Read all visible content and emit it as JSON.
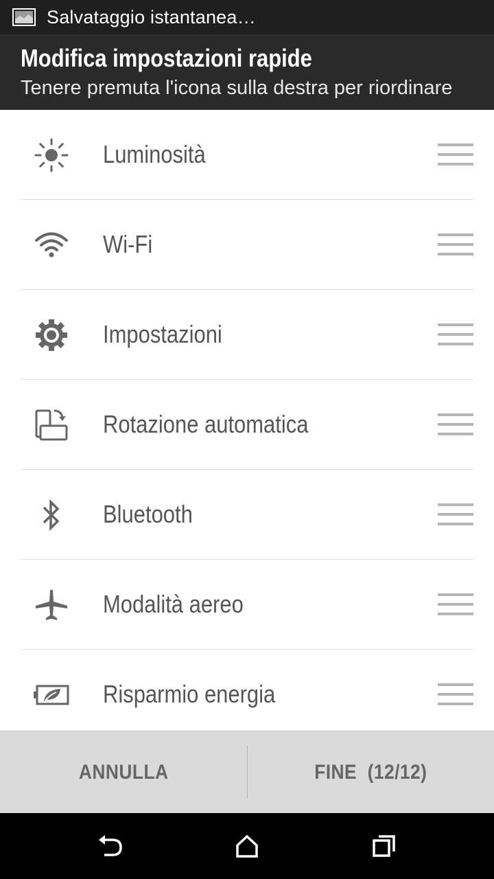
{
  "status_bar": {
    "notification_icon": "image-icon",
    "notification_text": "Salvataggio istantanea…"
  },
  "header": {
    "title": "Modifica impostazioni rapide",
    "subtitle": "Tenere premuta l'icona sulla destra per riordinare"
  },
  "items": [
    {
      "label": "Luminosità",
      "icon": "brightness-icon"
    },
    {
      "label": "Wi-Fi",
      "icon": "wifi-icon"
    },
    {
      "label": "Impostazioni",
      "icon": "gear-icon"
    },
    {
      "label": "Rotazione automatica",
      "icon": "auto-rotate-icon"
    },
    {
      "label": "Bluetooth",
      "icon": "bluetooth-icon"
    },
    {
      "label": "Modalità aereo",
      "icon": "airplane-icon"
    },
    {
      "label": "Risparmio energia",
      "icon": "power-saver-icon"
    }
  ],
  "actions": {
    "cancel_label": "ANNULLA",
    "done_label": "FINE  (12/12)"
  },
  "nav": {
    "back": "back-icon",
    "home": "home-icon",
    "recents": "recents-icon"
  },
  "colors": {
    "status_bar_bg": "#1f1f1f",
    "header_bg": "#2a2a2a",
    "list_text": "#555555",
    "icon": "#666666",
    "action_bar_bg": "#dadada"
  }
}
